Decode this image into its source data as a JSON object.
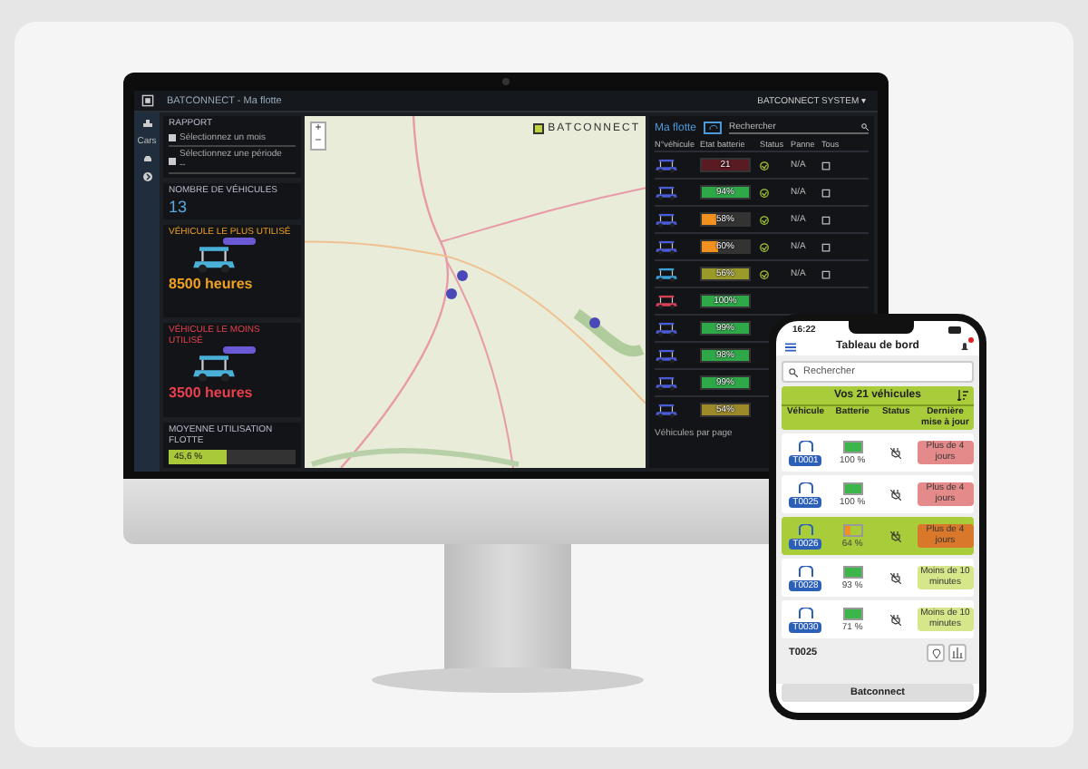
{
  "monitor": {
    "app_title": "BATCONNECT - Ma flotte",
    "account_menu": "BATCONNECT SYSTEM ▾",
    "sidebar_label": "Cars",
    "report": {
      "title": "RAPPORT",
      "month_placeholder": "Sélectionnez un mois",
      "period_placeholder": "Sélectionnez une période",
      "period_value": "--"
    },
    "vehicle_count": {
      "label": "NOMBRE DE VÉHICULES",
      "value": "13"
    },
    "usage_cards": [
      {
        "kind": "most",
        "label": "VÉHICULE LE PLUS UTILISÉ",
        "value": "8500 heures"
      },
      {
        "kind": "least",
        "label": "VÉHICULE LE MOINS UTILISÉ",
        "value": "3500 heures"
      }
    ],
    "fleet_usage": {
      "label": "MOYENNE UTILISATION FLOTTE",
      "level": 0.45,
      "reading": "45,6 %"
    },
    "map": {
      "zoom_in": "+",
      "zoom_out": "−",
      "logo": "BATCONNECT"
    },
    "fleet": {
      "title": "Ma flotte",
      "search_placeholder": "Rechercher",
      "columns": [
        "N°véhicule",
        "Etat batterie",
        "Status",
        "Panne",
        "Tous"
      ],
      "rows": [
        {
          "vehicle": {
            "color": "#4a5bd6"
          },
          "battery": {
            "reading": "21",
            "level": 1,
            "color": "#5a1a22"
          },
          "status": true,
          "fault": "N/A"
        },
        {
          "vehicle": {
            "color": "#4a5bd6"
          },
          "battery": {
            "reading": "94%",
            "level": 1,
            "color": "#2fa84a"
          },
          "status": true,
          "fault": "N/A"
        },
        {
          "vehicle": {
            "color": "#4a5bd6"
          },
          "battery": {
            "reading": "58%",
            "level": 0.3,
            "color": "#f0901e"
          },
          "status": true,
          "fault": "N/A"
        },
        {
          "vehicle": {
            "color": "#4a5bd6"
          },
          "battery": {
            "reading": "60%",
            "level": 0.35,
            "color": "#f0901e"
          },
          "status": true,
          "fault": "N/A"
        },
        {
          "vehicle": {
            "color": "#3aa0d8"
          },
          "battery": {
            "reading": "56%",
            "level": 1,
            "color": "#9a9a2a"
          },
          "status": true,
          "fault": "N/A"
        },
        {
          "vehicle": {
            "color": "#d8405a"
          },
          "battery": {
            "reading": "100%",
            "level": 1,
            "color": "#2fa84a"
          },
          "status": false
        },
        {
          "vehicle": {
            "color": "#4a5bd6"
          },
          "battery": {
            "reading": "99%",
            "level": 1,
            "color": "#2fa84a"
          },
          "status": false
        },
        {
          "vehicle": {
            "color": "#4a5bd6"
          },
          "battery": {
            "reading": "98%",
            "level": 1,
            "color": "#2fa84a"
          },
          "status": false
        },
        {
          "vehicle": {
            "color": "#4a5bd6"
          },
          "battery": {
            "reading": "99%",
            "level": 1,
            "color": "#2fa84a"
          },
          "status": false
        },
        {
          "vehicle": {
            "color": "#4a5bd6"
          },
          "battery": {
            "reading": "54%",
            "level": 1,
            "color": "#9a8a2a"
          },
          "status": false
        }
      ],
      "footer": "Véhicules par page"
    }
  },
  "phone": {
    "time": "16:22",
    "title": "Tableau de bord",
    "search_placeholder": "Rechercher",
    "fleet_header": "Vos 21 véhicules",
    "columns": [
      "Véhicule",
      "Batterie",
      "Status",
      "Dernière mise à jour"
    ],
    "rows": [
      {
        "vehicle": "T0001",
        "battery": "100 %",
        "level": 1,
        "update": "Plus de 4 jours",
        "color": "#e58a8a",
        "selected": false
      },
      {
        "vehicle": "T0025",
        "battery": "100 %",
        "level": 1,
        "update": "Plus de 4 jours",
        "color": "#e58a8a",
        "selected": false
      },
      {
        "vehicle": "T0026",
        "battery": "64 %",
        "level": 0.4,
        "update": "Plus de 4 jours",
        "color": "#d9782a",
        "selected": true
      },
      {
        "vehicle": "T0028",
        "battery": "93 %",
        "level": 1,
        "update": "Moins de 10 minutes",
        "color": "#d6e68a",
        "selected": false
      },
      {
        "vehicle": "T0030",
        "battery": "71 %",
        "level": 1,
        "update": "Moins de 10 minutes",
        "color": "#d6e68a",
        "selected": false
      }
    ],
    "bottom_vehicle": "T0025",
    "bottom_button": "Batconnect"
  }
}
